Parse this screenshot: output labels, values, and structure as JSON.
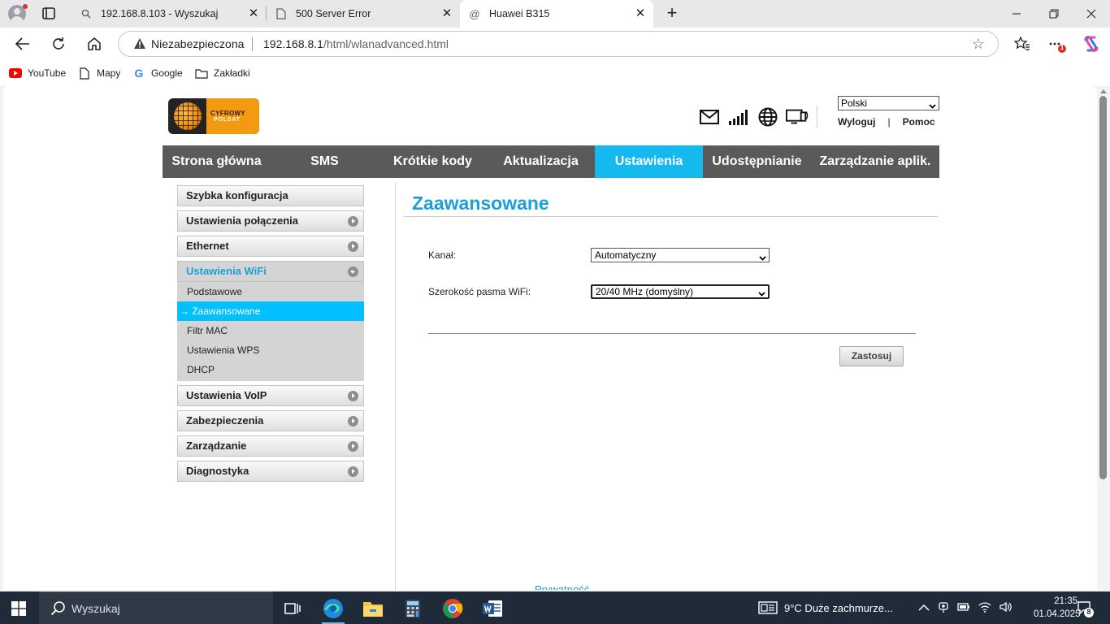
{
  "browser": {
    "tabs": [
      {
        "title": "192.168.8.103 - Wyszukaj",
        "icon": "search-icon"
      },
      {
        "title": "500 Server Error",
        "icon": "page-icon"
      },
      {
        "title": "Huawei B315",
        "icon": "at-icon",
        "active": true
      }
    ],
    "address": {
      "security_label": "Niezabezpieczona",
      "host": "192.168.8.1",
      "path": "/html/wlanadvanced.html"
    },
    "bookmarks": [
      {
        "label": "YouTube",
        "icon": "youtube-icon"
      },
      {
        "label": "Mapy",
        "icon": "page-icon"
      },
      {
        "label": "Google",
        "icon": "google-icon"
      },
      {
        "label": "Zakładki",
        "icon": "folder-icon"
      }
    ],
    "notification_count": "1"
  },
  "router": {
    "logo_text_line1": "CYFROWY",
    "logo_text_line2": "POLSAT",
    "language": "Polski",
    "logout": "Wyloguj",
    "help": "Pomoc",
    "nav": [
      {
        "label": "Strona główna"
      },
      {
        "label": "SMS"
      },
      {
        "label": "Krótkie kody"
      },
      {
        "label": "Aktualizacja"
      },
      {
        "label": "Ustawienia",
        "active": true
      },
      {
        "label": "Udostępnianie"
      },
      {
        "label": "Zarządzanie aplik."
      }
    ],
    "sidebar": {
      "quick": "Szybka konfiguracja",
      "connection": "Ustawienia połączenia",
      "ethernet": "Ethernet",
      "wifi": "Ustawienia WiFi",
      "wifi_sub": [
        "Podstawowe",
        "Zaawansowane",
        "Filtr MAC",
        "Ustawienia WPS",
        "DHCP"
      ],
      "wifi_sub_active_prefix": "→ ",
      "voip": "Ustawienia VoIP",
      "security": "Zabezpieczenia",
      "management": "Zarządzanie",
      "diagnostics": "Diagnostyka"
    },
    "page_title": "Zaawansowane",
    "form": {
      "channel_label": "Kanał:",
      "channel_value": "Automatyczny",
      "bandwidth_label": "Szerokość pasma WiFi:",
      "bandwidth_value": "20/40 MHz (domyślny)",
      "apply": "Zastosuj"
    },
    "footer_partial": "Prywatność"
  },
  "taskbar": {
    "search_placeholder": "Wyszukaj",
    "weather": "9°C  Duże zachmurze...",
    "time": "21:35",
    "date": "01.04.2025",
    "notification_count": "8"
  }
}
